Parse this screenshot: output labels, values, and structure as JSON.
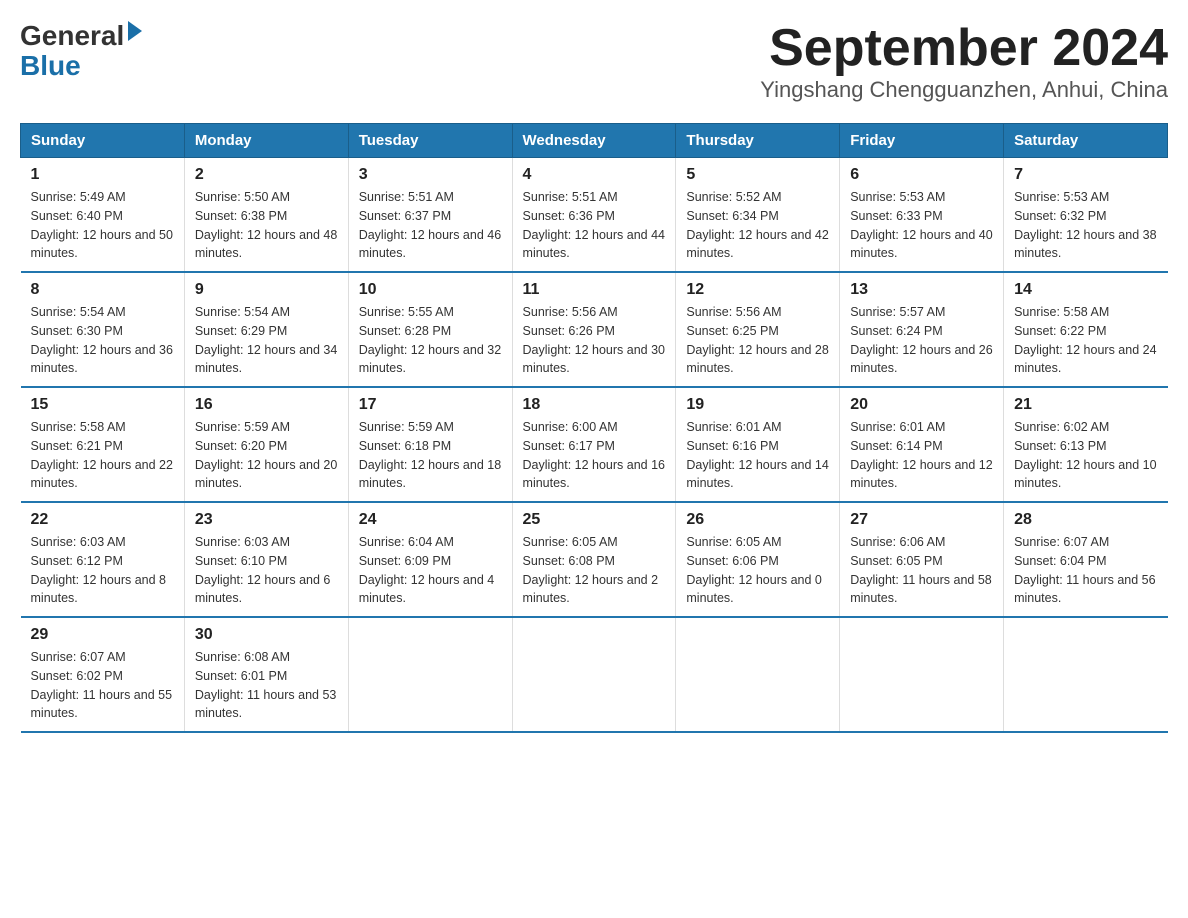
{
  "header": {
    "logo_general": "General",
    "logo_blue": "Blue",
    "month_title": "September 2024",
    "location": "Yingshang Chengguanzhen, Anhui, China"
  },
  "weekdays": [
    "Sunday",
    "Monday",
    "Tuesday",
    "Wednesday",
    "Thursday",
    "Friday",
    "Saturday"
  ],
  "weeks": [
    [
      {
        "day": "1",
        "sunrise": "5:49 AM",
        "sunset": "6:40 PM",
        "daylight": "12 hours and 50 minutes."
      },
      {
        "day": "2",
        "sunrise": "5:50 AM",
        "sunset": "6:38 PM",
        "daylight": "12 hours and 48 minutes."
      },
      {
        "day": "3",
        "sunrise": "5:51 AM",
        "sunset": "6:37 PM",
        "daylight": "12 hours and 46 minutes."
      },
      {
        "day": "4",
        "sunrise": "5:51 AM",
        "sunset": "6:36 PM",
        "daylight": "12 hours and 44 minutes."
      },
      {
        "day": "5",
        "sunrise": "5:52 AM",
        "sunset": "6:34 PM",
        "daylight": "12 hours and 42 minutes."
      },
      {
        "day": "6",
        "sunrise": "5:53 AM",
        "sunset": "6:33 PM",
        "daylight": "12 hours and 40 minutes."
      },
      {
        "day": "7",
        "sunrise": "5:53 AM",
        "sunset": "6:32 PM",
        "daylight": "12 hours and 38 minutes."
      }
    ],
    [
      {
        "day": "8",
        "sunrise": "5:54 AM",
        "sunset": "6:30 PM",
        "daylight": "12 hours and 36 minutes."
      },
      {
        "day": "9",
        "sunrise": "5:54 AM",
        "sunset": "6:29 PM",
        "daylight": "12 hours and 34 minutes."
      },
      {
        "day": "10",
        "sunrise": "5:55 AM",
        "sunset": "6:28 PM",
        "daylight": "12 hours and 32 minutes."
      },
      {
        "day": "11",
        "sunrise": "5:56 AM",
        "sunset": "6:26 PM",
        "daylight": "12 hours and 30 minutes."
      },
      {
        "day": "12",
        "sunrise": "5:56 AM",
        "sunset": "6:25 PM",
        "daylight": "12 hours and 28 minutes."
      },
      {
        "day": "13",
        "sunrise": "5:57 AM",
        "sunset": "6:24 PM",
        "daylight": "12 hours and 26 minutes."
      },
      {
        "day": "14",
        "sunrise": "5:58 AM",
        "sunset": "6:22 PM",
        "daylight": "12 hours and 24 minutes."
      }
    ],
    [
      {
        "day": "15",
        "sunrise": "5:58 AM",
        "sunset": "6:21 PM",
        "daylight": "12 hours and 22 minutes."
      },
      {
        "day": "16",
        "sunrise": "5:59 AM",
        "sunset": "6:20 PM",
        "daylight": "12 hours and 20 minutes."
      },
      {
        "day": "17",
        "sunrise": "5:59 AM",
        "sunset": "6:18 PM",
        "daylight": "12 hours and 18 minutes."
      },
      {
        "day": "18",
        "sunrise": "6:00 AM",
        "sunset": "6:17 PM",
        "daylight": "12 hours and 16 minutes."
      },
      {
        "day": "19",
        "sunrise": "6:01 AM",
        "sunset": "6:16 PM",
        "daylight": "12 hours and 14 minutes."
      },
      {
        "day": "20",
        "sunrise": "6:01 AM",
        "sunset": "6:14 PM",
        "daylight": "12 hours and 12 minutes."
      },
      {
        "day": "21",
        "sunrise": "6:02 AM",
        "sunset": "6:13 PM",
        "daylight": "12 hours and 10 minutes."
      }
    ],
    [
      {
        "day": "22",
        "sunrise": "6:03 AM",
        "sunset": "6:12 PM",
        "daylight": "12 hours and 8 minutes."
      },
      {
        "day": "23",
        "sunrise": "6:03 AM",
        "sunset": "6:10 PM",
        "daylight": "12 hours and 6 minutes."
      },
      {
        "day": "24",
        "sunrise": "6:04 AM",
        "sunset": "6:09 PM",
        "daylight": "12 hours and 4 minutes."
      },
      {
        "day": "25",
        "sunrise": "6:05 AM",
        "sunset": "6:08 PM",
        "daylight": "12 hours and 2 minutes."
      },
      {
        "day": "26",
        "sunrise": "6:05 AM",
        "sunset": "6:06 PM",
        "daylight": "12 hours and 0 minutes."
      },
      {
        "day": "27",
        "sunrise": "6:06 AM",
        "sunset": "6:05 PM",
        "daylight": "11 hours and 58 minutes."
      },
      {
        "day": "28",
        "sunrise": "6:07 AM",
        "sunset": "6:04 PM",
        "daylight": "11 hours and 56 minutes."
      }
    ],
    [
      {
        "day": "29",
        "sunrise": "6:07 AM",
        "sunset": "6:02 PM",
        "daylight": "11 hours and 55 minutes."
      },
      {
        "day": "30",
        "sunrise": "6:08 AM",
        "sunset": "6:01 PM",
        "daylight": "11 hours and 53 minutes."
      },
      null,
      null,
      null,
      null,
      null
    ]
  ]
}
